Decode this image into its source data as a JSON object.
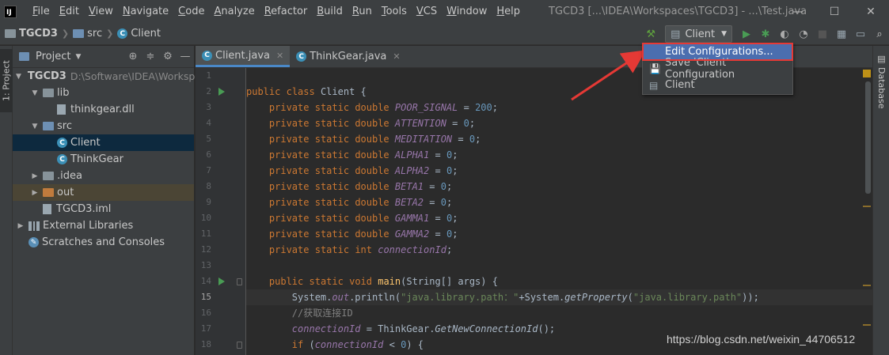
{
  "window": {
    "logo": "IJ",
    "title": "TGCD3 [...\\IDEA\\Workspaces\\TGCD3] - ...\\Test.java",
    "menus": [
      "File",
      "Edit",
      "View",
      "Navigate",
      "Code",
      "Analyze",
      "Refactor",
      "Build",
      "Run",
      "Tools",
      "VCS",
      "Window",
      "Help"
    ],
    "controls": {
      "minimize": "—",
      "maximize": "☐",
      "close": "✕"
    }
  },
  "breadcrumb": {
    "project": "TGCD3",
    "folder": "src",
    "file": "Client"
  },
  "toolbar": {
    "run_config": "Client",
    "icons": [
      "hammer-icon",
      "run-icon",
      "debug-icon",
      "coverage-icon",
      "profile-icon",
      "stop-icon",
      "project-structure-icon",
      "terminal-icon",
      "search-icon"
    ]
  },
  "run_menu": {
    "items": [
      {
        "label": "Edit Configurations...",
        "icon": "edit-config-icon"
      },
      {
        "label": "Save 'Client' Configuration",
        "icon": "save-icon"
      },
      {
        "label": "Client",
        "icon": "run-config-icon"
      }
    ]
  },
  "left_stripe": {
    "tab": "1: Project"
  },
  "right_stripe": {
    "tab": "Database"
  },
  "project_panel": {
    "title": "Project",
    "tree": [
      {
        "label": "TGCD3",
        "hint": "D:\\Software\\IDEA\\Workspaces",
        "indent": 0,
        "expanded": true,
        "icon": "module-folder",
        "bold": true
      },
      {
        "label": "lib",
        "indent": 1,
        "expanded": true,
        "icon": "folder"
      },
      {
        "label": "thinkgear.dll",
        "indent": 2,
        "icon": "file"
      },
      {
        "label": "src",
        "indent": 1,
        "expanded": true,
        "icon": "source-folder"
      },
      {
        "label": "Client",
        "indent": 2,
        "icon": "class",
        "selected": true
      },
      {
        "label": "ThinkGear",
        "indent": 2,
        "icon": "class"
      },
      {
        "label": ".idea",
        "indent": 1,
        "expanded": false,
        "icon": "folder"
      },
      {
        "label": "out",
        "indent": 1,
        "expanded": false,
        "icon": "excluded-folder",
        "highlight": true
      },
      {
        "label": "TGCD3.iml",
        "indent": 1,
        "icon": "file"
      },
      {
        "label": "External Libraries",
        "indent": 0,
        "expanded": false,
        "icon": "library"
      },
      {
        "label": "Scratches and Consoles",
        "indent": 0,
        "icon": "scratch"
      }
    ]
  },
  "editor": {
    "tabs": [
      {
        "label": "Client.java",
        "active": true
      },
      {
        "label": "ThinkGear.java",
        "active": false
      }
    ],
    "current_line": 15,
    "lines": [
      {
        "n": 1,
        "t": ""
      },
      {
        "n": 2,
        "t": "public class Client {"
      },
      {
        "n": 3,
        "t": "    private static double POOR_SIGNAL = 200;"
      },
      {
        "n": 4,
        "t": "    private static double ATTENTION = 0;"
      },
      {
        "n": 5,
        "t": "    private static double MEDITATION = 0;"
      },
      {
        "n": 6,
        "t": "    private static double ALPHA1 = 0;"
      },
      {
        "n": 7,
        "t": "    private static double ALPHA2 = 0;"
      },
      {
        "n": 8,
        "t": "    private static double BETA1 = 0;"
      },
      {
        "n": 9,
        "t": "    private static double BETA2 = 0;"
      },
      {
        "n": 10,
        "t": "    private static double GAMMA1 = 0;"
      },
      {
        "n": 11,
        "t": "    private static double GAMMA2 = 0;"
      },
      {
        "n": 12,
        "t": "    private static int connectionId;"
      },
      {
        "n": 13,
        "t": ""
      },
      {
        "n": 14,
        "t": "    public static void main(String[] args) {"
      },
      {
        "n": 15,
        "t": "        System.out.println(\"java.library.path：\"+System.getProperty(\"java.library.path\"));"
      },
      {
        "n": 16,
        "t": "        //获取连接ID"
      },
      {
        "n": 17,
        "t": "        connectionId = ThinkGear.GetNewConnectionId();"
      },
      {
        "n": 18,
        "t": "        if (connectionId < 0) {"
      }
    ]
  },
  "watermark": "https://blog.csdn.net/weixin_44706512",
  "colors": {
    "accent": "#4b6eaf",
    "highlight_border": "#e53935",
    "keyword": "#cc7832",
    "field": "#9876aa",
    "number": "#6897bb",
    "string": "#6a8759"
  }
}
